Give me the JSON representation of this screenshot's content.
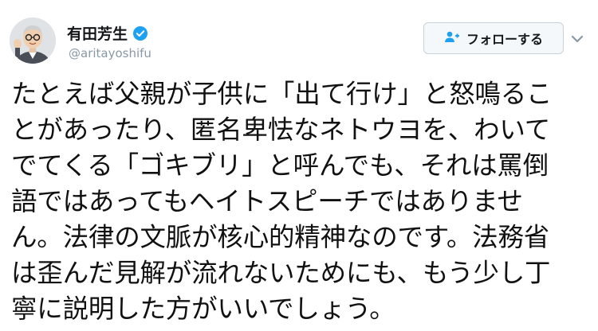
{
  "user": {
    "display_name": "有田芳生",
    "handle": "@aritayoshifu",
    "verified": true
  },
  "follow_button": {
    "label": "フォローする",
    "icon": "person-add-icon"
  },
  "menu": {
    "icon": "chevron-down-icon"
  },
  "tweet": {
    "lines": [
      "たとえば父親が子供に「出て行け」と怒鳴るこ",
      "とがあったり、匿名卑怯なネトウヨを、わいて",
      "でてくる「ゴキブリ」と呼んでも、それは罵倒",
      "語ではあってもヘイトスピーチではありませ",
      "ん。法律の文脈が核心的精神なのです。法務省",
      "は歪んだ見解が流れないためにも、もう少し丁",
      "寧に説明した方がいいでしょう。"
    ]
  },
  "colors": {
    "verified": "#1da1f2",
    "handle": "#8899a6",
    "text": "#111111"
  }
}
